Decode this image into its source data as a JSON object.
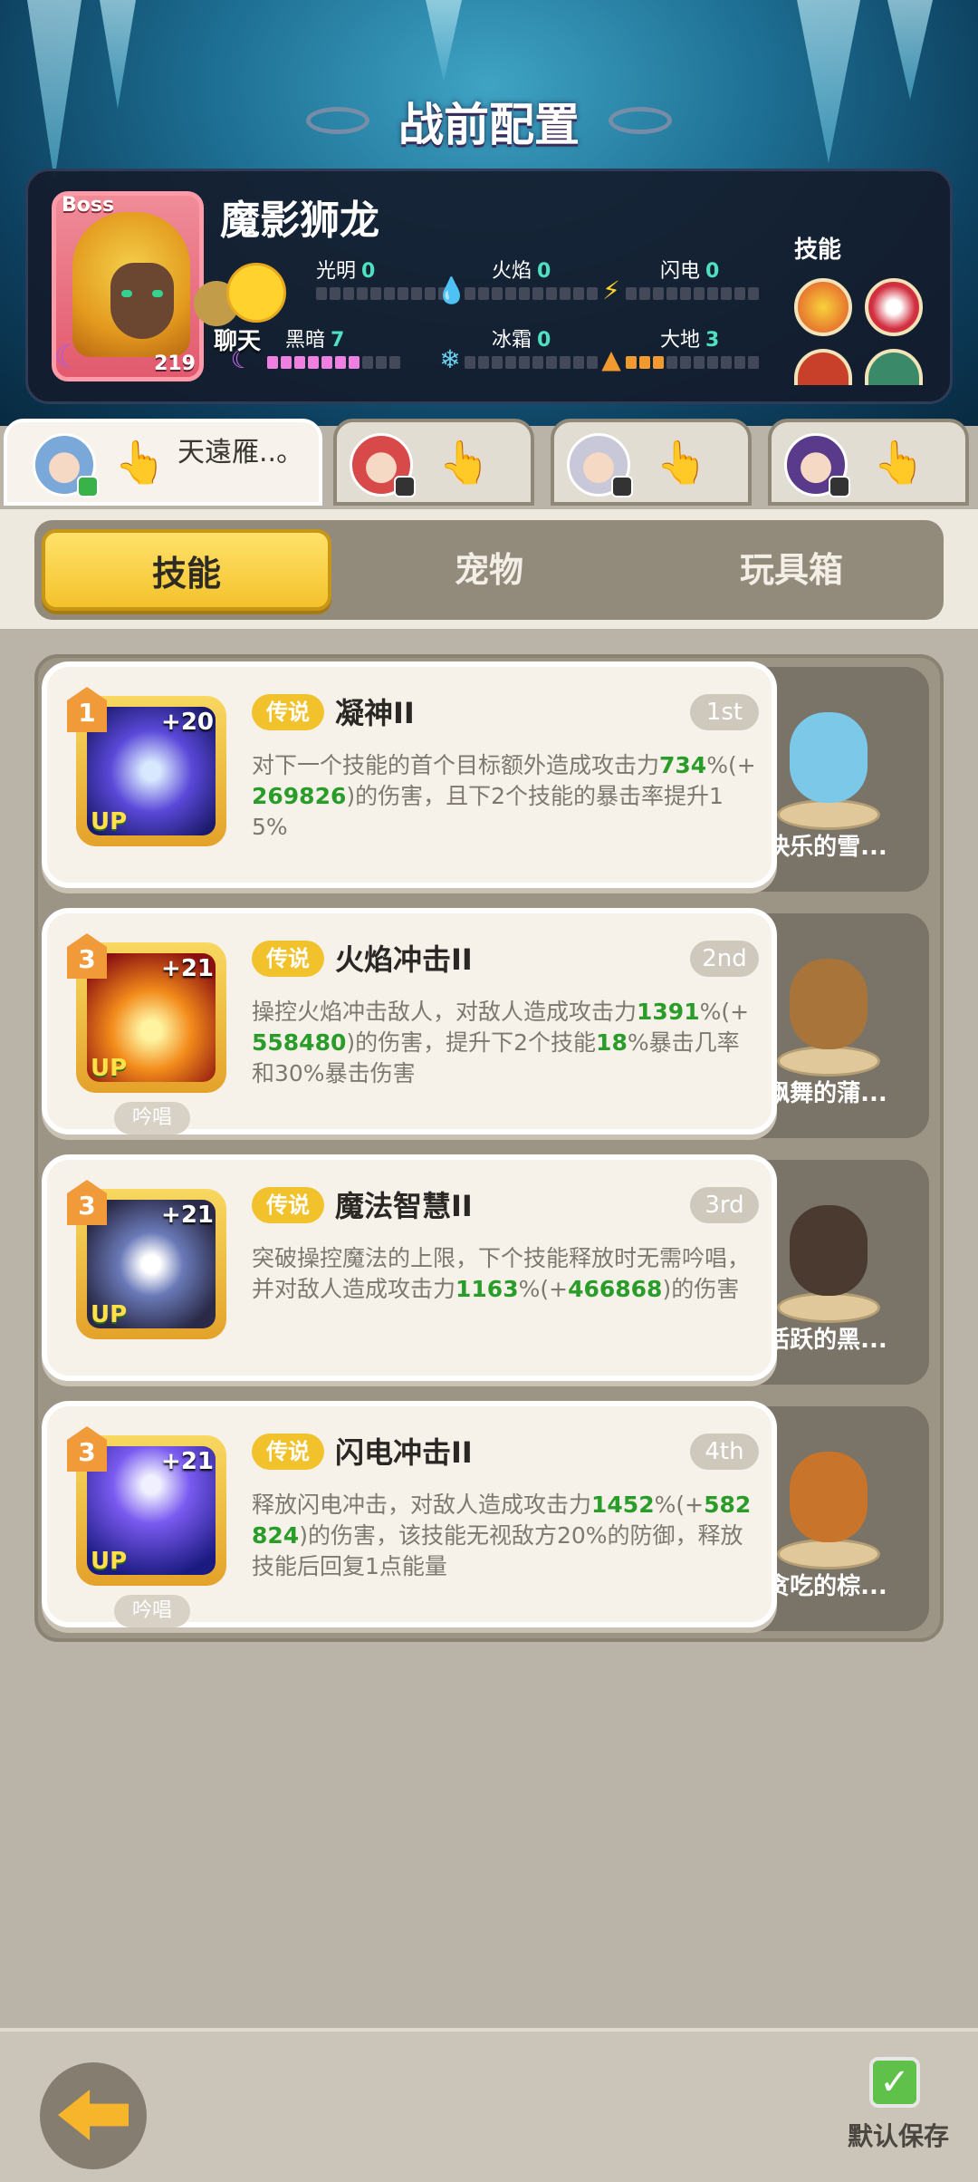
{
  "header": {
    "title": "战前配置"
  },
  "boss": {
    "tag": "Boss",
    "name": "魔影狮龙",
    "level": "219",
    "elements": [
      {
        "name": "光明",
        "value": "0",
        "icon": "light-icon"
      },
      {
        "name": "火焰",
        "value": "0",
        "icon": "fire-icon"
      },
      {
        "name": "闪电",
        "value": "0",
        "icon": "lightning-icon"
      },
      {
        "name": "黑暗",
        "value": "7",
        "icon": "moon-icon"
      },
      {
        "name": "冰霜",
        "value": "0",
        "icon": "snowflake-icon"
      },
      {
        "name": "大地",
        "value": "3",
        "icon": "earth-icon"
      }
    ],
    "skills_label": "技能"
  },
  "chat": {
    "label": "聊天"
  },
  "heroes": [
    {
      "name": "天遠雁..。",
      "active": true
    },
    {
      "name": "",
      "active": false
    },
    {
      "name": "",
      "active": false
    },
    {
      "name": "",
      "active": false
    }
  ],
  "categories": [
    "技能",
    "宠物",
    "玩具箱"
  ],
  "skills": [
    {
      "level": "1",
      "plus": "+20",
      "up": "UP",
      "rarity": "传说",
      "name": "凝神II",
      "order": "1st",
      "desc_parts": [
        "对下一个技能的首个目标额外造成攻击力",
        "734",
        "%(+",
        "269826",
        ")的伤害，且下2个技能的暴击率提升15%"
      ],
      "chant": ""
    },
    {
      "level": "3",
      "plus": "+21",
      "up": "UP",
      "rarity": "传说",
      "name": "火焰冲击II",
      "order": "2nd",
      "desc_parts": [
        "操控火焰冲击敌人，对敌人造成攻击力",
        "1391",
        "%(+",
        "558480",
        ")的伤害，提升下2个技能",
        "18",
        "%暴击几率和30%暴击伤害"
      ],
      "chant": "吟唱"
    },
    {
      "level": "3",
      "plus": "+21",
      "up": "UP",
      "rarity": "传说",
      "name": "魔法智慧II",
      "order": "3rd",
      "desc_parts": [
        "突破操控魔法的上限，下个技能释放时无需吟唱，并对敌人造成攻击力",
        "1163",
        "%(+",
        "466868",
        ")的伤害"
      ],
      "chant": ""
    },
    {
      "level": "3",
      "plus": "+21",
      "up": "UP",
      "rarity": "传说",
      "name": "闪电冲击II",
      "order": "4th",
      "desc_parts": [
        "释放闪电冲击，对敌人造成攻击力",
        "1452",
        "%(+",
        "582824",
        ")的伤害，该技能无视敌方20%的防御，释放技能后回复1点能量"
      ],
      "chant": "吟唱"
    }
  ],
  "pets": [
    "快乐的雪...",
    "飘舞的蒲...",
    "活跃的黑...",
    "贪吃的棕..."
  ],
  "footer": {
    "save_label": "默认保存"
  },
  "colors": {
    "accent": "#f4c22c",
    "highlight_number": "#2a9c2a",
    "dark_bar": "#f080e0",
    "earth_bar": "#f29a30"
  }
}
